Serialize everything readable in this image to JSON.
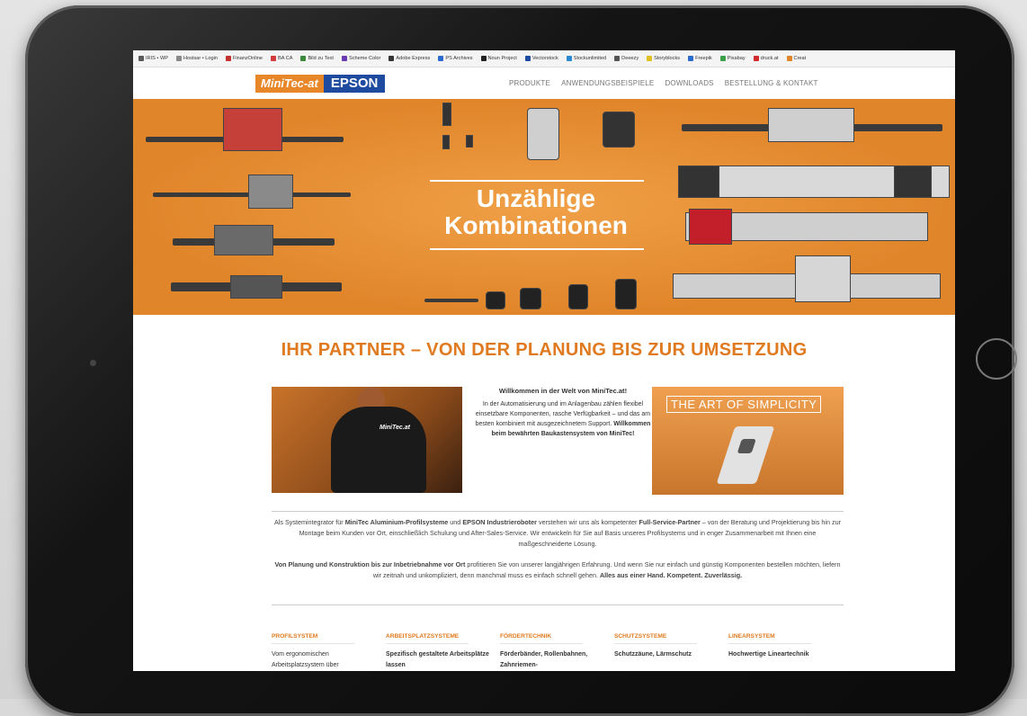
{
  "bookmarks": [
    {
      "label": "IRIS • WP",
      "color": "#5a5a5a"
    },
    {
      "label": "Hostsar • Login",
      "color": "#888888"
    },
    {
      "label": "FinanzOnline",
      "color": "#c4322f"
    },
    {
      "label": "BA CA",
      "color": "#d13b3b"
    },
    {
      "label": "Bild zu Text",
      "color": "#3a8a3a"
    },
    {
      "label": "Scheme Color",
      "color": "#6a3ab0"
    },
    {
      "label": "Adobe Express",
      "color": "#333333"
    },
    {
      "label": "PS Archives",
      "color": "#2a6ad1"
    },
    {
      "label": "Noun Project",
      "color": "#222222"
    },
    {
      "label": "Vectorstock",
      "color": "#1e4aa0"
    },
    {
      "label": "Stockunlimited",
      "color": "#2a8ad1"
    },
    {
      "label": "Deeezy",
      "color": "#555555"
    },
    {
      "label": "Storyblocks",
      "color": "#e0c020"
    },
    {
      "label": "Freepik",
      "color": "#2a6ad1"
    },
    {
      "label": "Pixabay",
      "color": "#3aa04a"
    },
    {
      "label": "druck.at",
      "color": "#d12a2a"
    },
    {
      "label": "Creat",
      "color": "#e0852a"
    }
  ],
  "logo": {
    "minitec": "MiniTec-at",
    "epson": "EPSON"
  },
  "nav": [
    "PRODUKTE",
    "ANWENDUNGSBEISPIELE",
    "DOWNLOADS",
    "BESTELLUNG & KONTAKT"
  ],
  "hero": {
    "line1": "Unzählige",
    "line2": "Kombinationen"
  },
  "headline": "IHR PARTNER – VON DER PLANUNG BIS ZUR UMSETZUNG",
  "photo_left_logo": "MiniTec.at",
  "welcome": {
    "title": "Willkommen in der Welt von MiniTec.at!",
    "text": "In der Automatisierung und im Anlagenbau zählen flexibel einsetzbare Komponenten, rasche Verfügbarkeit – und das am besten kombiniert mit ausgezeichnetem Support.",
    "bold": "Willkommen beim bewährten Baukastensystem von MiniTec!"
  },
  "art_label": "THE ART OF SIMPLICITY",
  "para1": {
    "a": "Als Systemintegrator für ",
    "b": "MiniTec Aluminium-Profilsysteme",
    "c": " und ",
    "d": "EPSON Industrieroboter",
    "e": " verstehen wir uns als kompetenter ",
    "f": "Full-Service-Partner",
    "g": " – von der Beratung und Projektierung bis hin zur Montage beim Kunden vor Ort, einschließlich Schulung und After-Sales-Service. Wir entwickeln für Sie auf Basis unseres Profilsystems und in enger Zusammenarbeit mit Ihnen eine maßgeschneiderte Lösung."
  },
  "para2": {
    "a": "Von Planung und Konstruktion bis zur Inbetriebnahme vor Ort",
    "b": " profitieren Sie von unserer langjährigen Erfahrung. Und wenn Sie nur einfach und günstig Komponenten bestellen möchten, liefern wir zeitnah und unkompliziert, denn manchmal muss es einfach schnell gehen. ",
    "c": "Alles aus einer Hand. Kompetent. Zuverlässig."
  },
  "columns": [
    {
      "title": "PROFILSYSTEM",
      "text": "Vom ergonomischen Arbeitsplatzsystem über"
    },
    {
      "title": "ARBEITSPLATZSYSTEME",
      "text": "Spezifisch gestaltete Arbeitsplätze lassen"
    },
    {
      "title": "FÖRDERTECHNIK",
      "text": "Förderbänder, Rollenbahnen, Zahnriemen-"
    },
    {
      "title": "SCHUTZSYSTEME",
      "text": "Schutzzäune, Lärmschutz"
    },
    {
      "title": "LINEARSYSTEM",
      "text": "Hochwertige Lineartechnik"
    }
  ]
}
